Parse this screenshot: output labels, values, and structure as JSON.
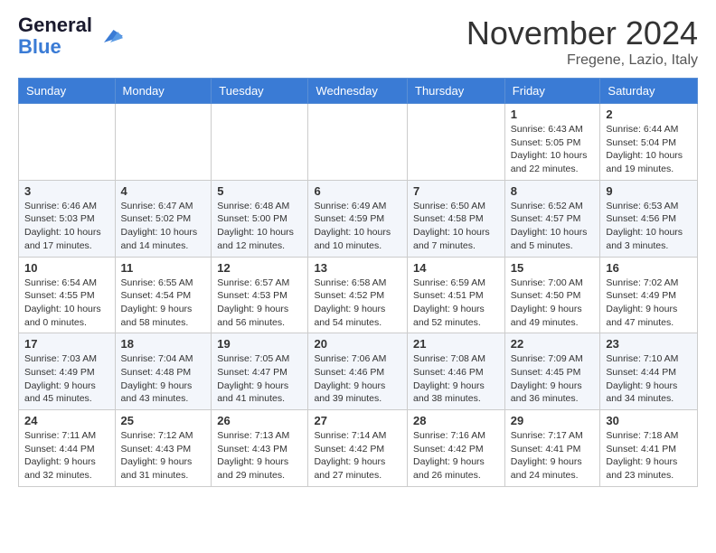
{
  "header": {
    "logo_line1": "General",
    "logo_line2": "Blue",
    "month_title": "November 2024",
    "location": "Fregene, Lazio, Italy"
  },
  "columns": [
    "Sunday",
    "Monday",
    "Tuesday",
    "Wednesday",
    "Thursday",
    "Friday",
    "Saturday"
  ],
  "weeks": [
    [
      {
        "day": "",
        "info": ""
      },
      {
        "day": "",
        "info": ""
      },
      {
        "day": "",
        "info": ""
      },
      {
        "day": "",
        "info": ""
      },
      {
        "day": "",
        "info": ""
      },
      {
        "day": "1",
        "info": "Sunrise: 6:43 AM\nSunset: 5:05 PM\nDaylight: 10 hours and 22 minutes."
      },
      {
        "day": "2",
        "info": "Sunrise: 6:44 AM\nSunset: 5:04 PM\nDaylight: 10 hours and 19 minutes."
      }
    ],
    [
      {
        "day": "3",
        "info": "Sunrise: 6:46 AM\nSunset: 5:03 PM\nDaylight: 10 hours and 17 minutes."
      },
      {
        "day": "4",
        "info": "Sunrise: 6:47 AM\nSunset: 5:02 PM\nDaylight: 10 hours and 14 minutes."
      },
      {
        "day": "5",
        "info": "Sunrise: 6:48 AM\nSunset: 5:00 PM\nDaylight: 10 hours and 12 minutes."
      },
      {
        "day": "6",
        "info": "Sunrise: 6:49 AM\nSunset: 4:59 PM\nDaylight: 10 hours and 10 minutes."
      },
      {
        "day": "7",
        "info": "Sunrise: 6:50 AM\nSunset: 4:58 PM\nDaylight: 10 hours and 7 minutes."
      },
      {
        "day": "8",
        "info": "Sunrise: 6:52 AM\nSunset: 4:57 PM\nDaylight: 10 hours and 5 minutes."
      },
      {
        "day": "9",
        "info": "Sunrise: 6:53 AM\nSunset: 4:56 PM\nDaylight: 10 hours and 3 minutes."
      }
    ],
    [
      {
        "day": "10",
        "info": "Sunrise: 6:54 AM\nSunset: 4:55 PM\nDaylight: 10 hours and 0 minutes."
      },
      {
        "day": "11",
        "info": "Sunrise: 6:55 AM\nSunset: 4:54 PM\nDaylight: 9 hours and 58 minutes."
      },
      {
        "day": "12",
        "info": "Sunrise: 6:57 AM\nSunset: 4:53 PM\nDaylight: 9 hours and 56 minutes."
      },
      {
        "day": "13",
        "info": "Sunrise: 6:58 AM\nSunset: 4:52 PM\nDaylight: 9 hours and 54 minutes."
      },
      {
        "day": "14",
        "info": "Sunrise: 6:59 AM\nSunset: 4:51 PM\nDaylight: 9 hours and 52 minutes."
      },
      {
        "day": "15",
        "info": "Sunrise: 7:00 AM\nSunset: 4:50 PM\nDaylight: 9 hours and 49 minutes."
      },
      {
        "day": "16",
        "info": "Sunrise: 7:02 AM\nSunset: 4:49 PM\nDaylight: 9 hours and 47 minutes."
      }
    ],
    [
      {
        "day": "17",
        "info": "Sunrise: 7:03 AM\nSunset: 4:49 PM\nDaylight: 9 hours and 45 minutes."
      },
      {
        "day": "18",
        "info": "Sunrise: 7:04 AM\nSunset: 4:48 PM\nDaylight: 9 hours and 43 minutes."
      },
      {
        "day": "19",
        "info": "Sunrise: 7:05 AM\nSunset: 4:47 PM\nDaylight: 9 hours and 41 minutes."
      },
      {
        "day": "20",
        "info": "Sunrise: 7:06 AM\nSunset: 4:46 PM\nDaylight: 9 hours and 39 minutes."
      },
      {
        "day": "21",
        "info": "Sunrise: 7:08 AM\nSunset: 4:46 PM\nDaylight: 9 hours and 38 minutes."
      },
      {
        "day": "22",
        "info": "Sunrise: 7:09 AM\nSunset: 4:45 PM\nDaylight: 9 hours and 36 minutes."
      },
      {
        "day": "23",
        "info": "Sunrise: 7:10 AM\nSunset: 4:44 PM\nDaylight: 9 hours and 34 minutes."
      }
    ],
    [
      {
        "day": "24",
        "info": "Sunrise: 7:11 AM\nSunset: 4:44 PM\nDaylight: 9 hours and 32 minutes."
      },
      {
        "day": "25",
        "info": "Sunrise: 7:12 AM\nSunset: 4:43 PM\nDaylight: 9 hours and 31 minutes."
      },
      {
        "day": "26",
        "info": "Sunrise: 7:13 AM\nSunset: 4:43 PM\nDaylight: 9 hours and 29 minutes."
      },
      {
        "day": "27",
        "info": "Sunrise: 7:14 AM\nSunset: 4:42 PM\nDaylight: 9 hours and 27 minutes."
      },
      {
        "day": "28",
        "info": "Sunrise: 7:16 AM\nSunset: 4:42 PM\nDaylight: 9 hours and 26 minutes."
      },
      {
        "day": "29",
        "info": "Sunrise: 7:17 AM\nSunset: 4:41 PM\nDaylight: 9 hours and 24 minutes."
      },
      {
        "day": "30",
        "info": "Sunrise: 7:18 AM\nSunset: 4:41 PM\nDaylight: 9 hours and 23 minutes."
      }
    ]
  ]
}
